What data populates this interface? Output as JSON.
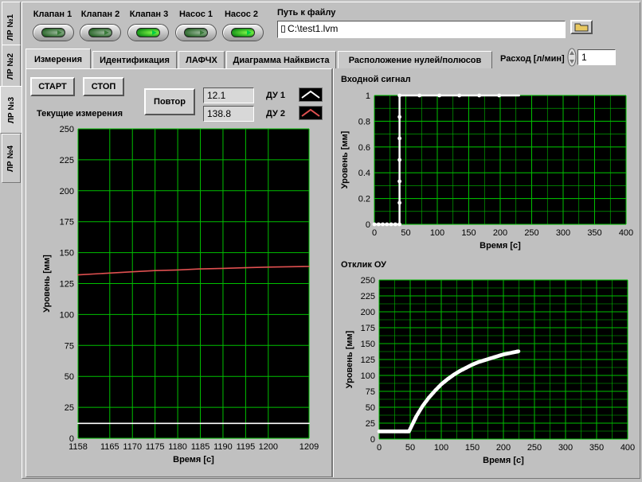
{
  "left_tabs": [
    {
      "label": "ЛР №1"
    },
    {
      "label": "ЛР №2"
    },
    {
      "label": "ЛР №3"
    },
    {
      "label": "ЛР №4"
    }
  ],
  "toggles": [
    {
      "label": "Клапан 1",
      "on": false
    },
    {
      "label": "Клапан 2",
      "on": false
    },
    {
      "label": "Клапан 3",
      "on": true
    },
    {
      "label": "Насос 1",
      "on": false
    },
    {
      "label": "Насос 2",
      "on": true
    }
  ],
  "file": {
    "label": "Путь к файлу",
    "value": "C:\\test1.lvm",
    "browse_icon": "folder-icon"
  },
  "tabs": [
    {
      "label": "Измерения"
    },
    {
      "label": "Идентификация"
    },
    {
      "label": "ЛАФЧХ"
    },
    {
      "label": "Диаграмма Найквиста"
    },
    {
      "label": "Расположение нулей/полюсов"
    }
  ],
  "flow": {
    "label": "Расход [л/мин]",
    "value": "1"
  },
  "controls": {
    "start_label": "СТАРТ",
    "stop_label": "СТОП",
    "repeat_label": "Повтор",
    "current_title": "Текущие измерения",
    "value1": "12.1",
    "value2": "138.8",
    "legend1": "ДУ 1",
    "legend2": "ДУ 2"
  },
  "colors": {
    "series1": "#ffffff",
    "series2": "#e05050",
    "grid": "#00c000",
    "plot_bg": "#000000",
    "accent": "#00a000"
  },
  "chart_data": [
    {
      "type": "line",
      "title": "Текущие измерения",
      "xlabel": "Время [с]",
      "ylabel": "Уровень [мм]",
      "xlim": [
        1158,
        1209
      ],
      "ylim": [
        0,
        250
      ],
      "x_ticks": [
        1158,
        1165,
        1170,
        1175,
        1180,
        1185,
        1190,
        1195,
        1200,
        1209
      ],
      "y_ticks": [
        0,
        25,
        50,
        75,
        100,
        125,
        150,
        175,
        200,
        225,
        250
      ],
      "series": [
        {
          "name": "ДУ 1",
          "x": [
            1158,
            1170,
            1180,
            1190,
            1200,
            1209
          ],
          "values": [
            12,
            12,
            12,
            12,
            12,
            12
          ]
        },
        {
          "name": "ДУ 2",
          "x": [
            1158,
            1165,
            1170,
            1175,
            1180,
            1185,
            1190,
            1195,
            1200,
            1209
          ],
          "values": [
            132,
            133.5,
            134.5,
            135.5,
            136,
            136.8,
            137.3,
            137.8,
            138.3,
            138.8
          ]
        }
      ]
    },
    {
      "type": "line",
      "title": "Входной сигнал",
      "xlabel": "Время [с]",
      "ylabel": "Уровень [мм]",
      "xlim": [
        0,
        400
      ],
      "ylim": [
        0,
        1
      ],
      "x_ticks": [
        0,
        50,
        100,
        150,
        200,
        250,
        300,
        350,
        400
      ],
      "y_ticks": [
        0,
        0.2,
        0.4,
        0.6,
        0.8,
        1
      ],
      "series": [
        {
          "x": [
            0,
            40,
            40,
            230
          ],
          "values": [
            0,
            0,
            1,
            1
          ]
        }
      ]
    },
    {
      "type": "line",
      "title": "Отклик ОУ",
      "xlabel": "Время [с]",
      "ylabel": "Уровень [мм]",
      "xlim": [
        0,
        400
      ],
      "ylim": [
        0,
        250
      ],
      "x_ticks": [
        0,
        50,
        100,
        150,
        200,
        250,
        300,
        350,
        400
      ],
      "y_ticks": [
        0,
        25,
        50,
        75,
        100,
        125,
        150,
        175,
        200,
        225,
        250
      ],
      "series": [
        {
          "x": [
            0,
            10,
            20,
            30,
            40,
            48,
            55,
            60,
            70,
            80,
            90,
            100,
            110,
            120,
            130,
            140,
            150,
            160,
            170,
            180,
            190,
            200,
            210,
            220,
            225
          ],
          "values": [
            12,
            12,
            12,
            12,
            12,
            12,
            26,
            36,
            52,
            65,
            76,
            86,
            94,
            101,
            107,
            112,
            117,
            121,
            124,
            127,
            130,
            133,
            135,
            137,
            138
          ]
        }
      ]
    }
  ]
}
